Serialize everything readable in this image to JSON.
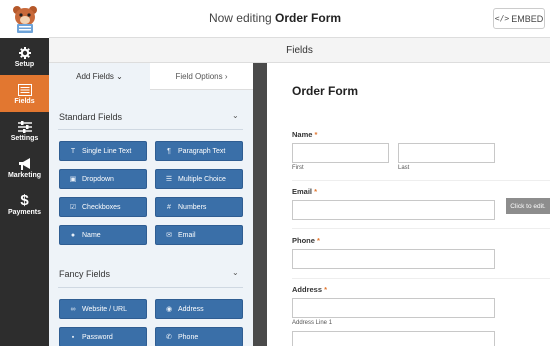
{
  "topbar": {
    "title_prefix": "Now editing ",
    "title_form": "Order Form",
    "embed_code_icon": "</>",
    "embed_label": "EMBED"
  },
  "sidebar": {
    "items": [
      {
        "label": "Setup",
        "icon": "gear-icon"
      },
      {
        "label": "Fields",
        "icon": "list-icon",
        "active": true
      },
      {
        "label": "Settings",
        "icon": "sliders-icon"
      },
      {
        "label": "Marketing",
        "icon": "megaphone-icon"
      },
      {
        "label": "Payments",
        "icon": "dollar-icon"
      }
    ]
  },
  "header": {
    "title": "Fields"
  },
  "panel": {
    "tab_add": "Add Fields ⌄",
    "tab_options": "Field Options ›",
    "standard": {
      "title": "Standard Fields",
      "buttons": [
        "Single Line Text",
        "Paragraph Text",
        "Dropdown",
        "Multiple Choice",
        "Checkboxes",
        "Numbers",
        "Name",
        "Email"
      ]
    },
    "fancy": {
      "title": "Fancy Fields",
      "buttons": [
        "Website / URL",
        "Address",
        "Password",
        "Phone"
      ]
    },
    "chevron": "⌄"
  },
  "preview": {
    "form_title": "Order Form",
    "name_label": "Name",
    "first": "First",
    "last": "Last",
    "email_label": "Email",
    "phone_label": "Phone",
    "address_label": "Address",
    "address_line1": "Address Line 1",
    "required_mark": "*",
    "click_tip": "Click to edit."
  },
  "colors": {
    "accent": "#e27730",
    "button_blue": "#3a6fa8",
    "sidebar_bg": "#2d2d2d"
  }
}
